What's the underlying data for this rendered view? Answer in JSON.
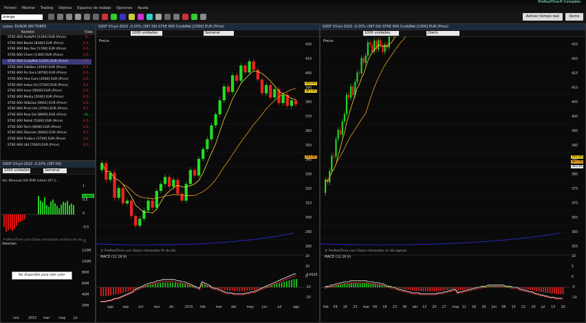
{
  "app": {
    "title": "ProRealTime® Complete"
  },
  "menu": [
    "Fichero",
    "Mostrar",
    "Trading",
    "Objetos",
    "Espacios de trabajo",
    "Opciones",
    "Ayuda"
  ],
  "toolbar": {
    "activar_label": "Activar tiempo real",
    "demo_label": "Demo"
  },
  "search": {
    "value": "orange"
  },
  "watchlist": {
    "title": "Listas: EURO6 SECTORES",
    "col_name": "Nombre",
    "col_change": "%Var.",
    "selected_index": 4,
    "rows": [
      {
        "name": "STXE 600 Aut&Prt [2300] EUR (Price)",
        "change": "-0,..."
      },
      {
        "name": "STXE 600 Banks [8300] EUR (Price)",
        "change": "-0,5..."
      },
      {
        "name": "STXE 600 Bas Res [1700] EUR (Price)",
        "change": "-0,5..."
      },
      {
        "name": "STXE 600 Chem [1300] EUR (Price)",
        "change": "-0,5..."
      },
      {
        "name": "STXE 600 Cns&Mat [2300] EUR (Price)",
        "change": "-0,5..."
      },
      {
        "name": "STXE 600 Fd&Bev [3500] EUR (Price)",
        "change": "-0,5..."
      },
      {
        "name": "STXE 600 Fin Svcs [8700] EUR (Price)",
        "change": "-0,5..."
      },
      {
        "name": "STXE 600 Hea Care [4500] EUR (Price)",
        "change": "-0,5..."
      },
      {
        "name": "STXE 600 Indus Gd [2700] EUR (Price)",
        "change": "-0,5..."
      },
      {
        "name": "STXE 600 Insur [8500] EUR (Price)",
        "change": "-0,5..."
      },
      {
        "name": "STXE 600 Media [5500] EUR (Price)",
        "change": "-0,5..."
      },
      {
        "name": "STXE 600 Oil&Gas [0001] EUR (Price)",
        "change": "-0,5..."
      },
      {
        "name": "STXE 600 Prsnl Hsl [3700] EUR (Price)",
        "change": "-0,5..."
      },
      {
        "name": "STXE 600 Real Est [8600] EUR (Price)",
        "change": "+0,..."
      },
      {
        "name": "STXE 600 Retail [5300] EUR (Price)",
        "change": "-0,5..."
      },
      {
        "name": "STXE 600 Tech [9000] EUR (Price)",
        "change": "-0,5..."
      },
      {
        "name": "STXE 600 Telecom [6000] EUR (Price)",
        "change": "-0,5..."
      },
      {
        "name": "STXE 600 Trv&Lsr [5700] EUR (Price)",
        "change": "-0,5..."
      },
      {
        "name": "STXE 600 Util [7000] EUR (Price)",
        "change": "-0,5..."
      }
    ]
  },
  "mini_chart": {
    "header": "SXOF  03-jul-2015  -0.20% (387.00)",
    "units_select": "1000 unidades",
    "period_select": "Semanal",
    "indicator_title": "Vol. Mensual (SX.PHR Index) [67.1...",
    "y_ticks": [
      "1",
      "0,5",
      "0",
      "-0,5",
      "-1"
    ],
    "price_tag": "0,0885",
    "watermark": "ProRealTime.com  Datos retrasados mínimo de día",
    "volume_title": "Volumen",
    "volume_ticks": [
      "120M",
      "100M",
      "80M",
      "60M",
      "40M",
      "20M"
    ],
    "unavailable_text": "No disponible para este valor",
    "x_ticks": [
      "nov",
      "2015",
      "mar",
      "may",
      "jul"
    ]
  },
  "chart_weekly": {
    "header": "SXOF  03-jul-2015  -0.20% (387.00)  STXE 600 Cns&Mat [2300] EUR (Price)",
    "units_select": "1000 unidades",
    "period_select": "Semanal",
    "price_label": "Precio",
    "watermark": "© ProRealTime.com  Datos retrasados fin de día",
    "y_ticks": [
      "420",
      "410",
      "400",
      "390",
      "380",
      "370",
      "360",
      "350",
      "340",
      "330",
      "320",
      "310",
      "300",
      "290",
      "280"
    ],
    "last_price_tags": [
      "392,05",
      "387,00"
    ],
    "ma_tag": "331,80",
    "macd_title": "MACD (12 26 9)",
    "macd_ticks": [
      "20",
      "10",
      "0",
      "-10",
      "-20"
    ],
    "macd_tag": "-5,9125",
    "x_ticks": [
      "ago",
      "sep",
      "oct",
      "nov",
      "dic",
      "2015",
      "feb",
      "mar",
      "abr",
      "may",
      "jun",
      "jul",
      "ago"
    ],
    "chart_data": {
      "type": "candlestick",
      "ylim": [
        280,
        425
      ],
      "candles": [
        [
          340,
          345
        ],
        [
          345,
          333
        ],
        [
          333,
          338
        ],
        [
          338,
          320
        ],
        [
          320,
          327
        ],
        [
          327,
          316
        ],
        [
          316,
          318
        ],
        [
          318,
          307
        ],
        [
          307,
          300
        ],
        [
          300,
          305
        ],
        [
          305,
          311
        ],
        [
          311,
          318
        ],
        [
          318,
          313
        ],
        [
          313,
          325
        ],
        [
          325,
          330
        ],
        [
          330,
          335
        ],
        [
          335,
          328
        ],
        [
          328,
          333
        ],
        [
          333,
          323
        ],
        [
          323,
          318
        ],
        [
          318,
          330
        ],
        [
          330,
          340
        ],
        [
          340,
          336
        ],
        [
          336,
          348
        ],
        [
          348,
          355
        ],
        [
          355,
          362
        ],
        [
          362,
          372
        ],
        [
          372,
          380
        ],
        [
          380,
          390
        ],
        [
          390,
          400
        ],
        [
          400,
          396
        ],
        [
          396,
          408
        ],
        [
          408,
          404
        ],
        [
          404,
          415
        ],
        [
          415,
          410
        ],
        [
          410,
          418
        ],
        [
          418,
          412
        ],
        [
          412,
          405
        ],
        [
          405,
          395
        ],
        [
          395,
          401
        ],
        [
          401,
          392
        ],
        [
          392,
          398
        ],
        [
          398,
          388
        ],
        [
          388,
          394
        ],
        [
          394,
          386
        ],
        [
          386,
          390
        ],
        [
          390,
          387
        ]
      ]
    }
  },
  "chart_daily": {
    "header": "SXOF  03-jul-2015  -0.20% (387.00)  STXE 600 Cns&Mat [2300] EUR (Price)",
    "units_select": "1000 unidades",
    "period_select": "Diario",
    "price_label": "Precio",
    "watermark": "© ProRealTime.com  Datos retrasados en día agosto",
    "y_ticks": [
      "425",
      "420",
      "415",
      "410",
      "405",
      "400",
      "395",
      "390",
      "385",
      "380",
      "375",
      "370",
      "365",
      "360",
      "355"
    ],
    "last_price_tags": [
      "391,64",
      "387,00",
      "382,64"
    ],
    "macd_title": "MACD (12 26 9)",
    "macd_ticks": [
      "10",
      "5",
      "0",
      "-5",
      "-10"
    ],
    "x_ticks": [
      "feb",
      "09",
      "16",
      "23",
      "mar",
      "09",
      "16",
      "23",
      "30",
      "abr",
      "13",
      "20",
      "27",
      "may",
      "11",
      "18",
      "26",
      "jun",
      "08",
      "15",
      "22",
      "29",
      "jul",
      "13",
      "20"
    ]
  }
}
